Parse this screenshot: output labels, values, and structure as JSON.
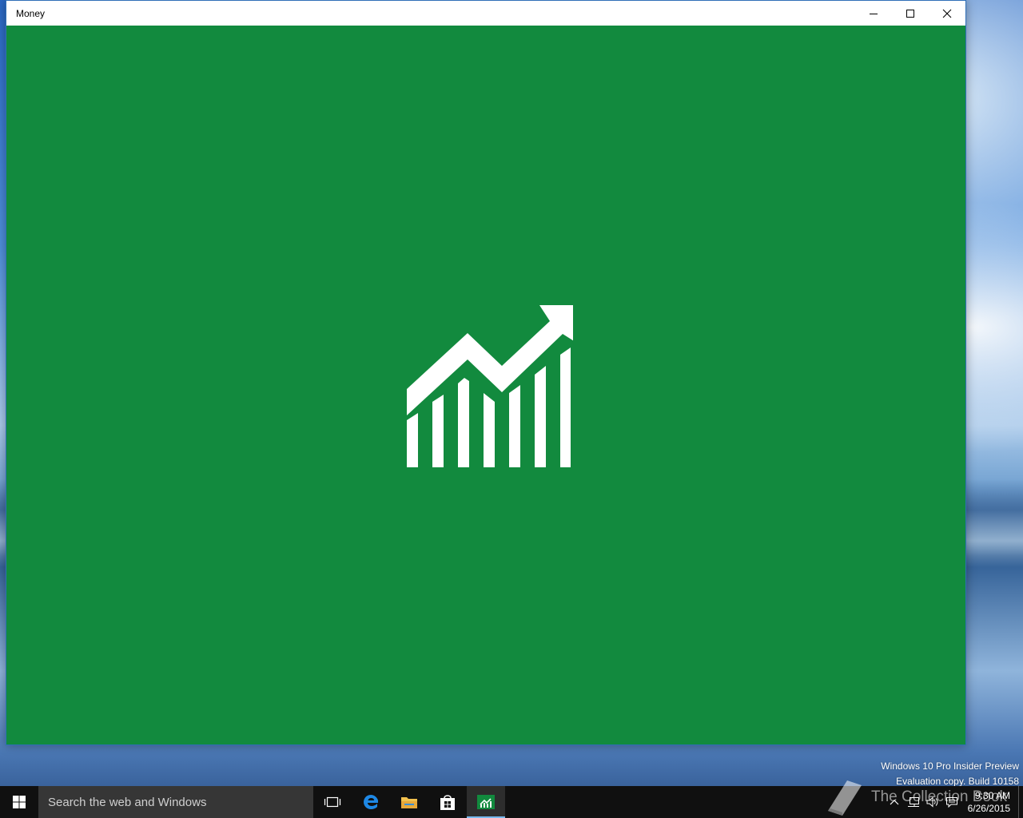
{
  "window": {
    "title": "Money",
    "accent_color": "#128a3e"
  },
  "taskbar": {
    "search_placeholder": "Search the web and Windows",
    "pinned": [
      "task-view",
      "edge",
      "file-explorer",
      "store",
      "money"
    ],
    "active_app": "money"
  },
  "watermark": {
    "line1": "Windows 10 Pro Insider Preview",
    "line2": "Evaluation copy. Build 10158",
    "overlay_text": "The Collection Book"
  },
  "clock": {
    "time": "9:30 AM",
    "date": "6/26/2015"
  }
}
